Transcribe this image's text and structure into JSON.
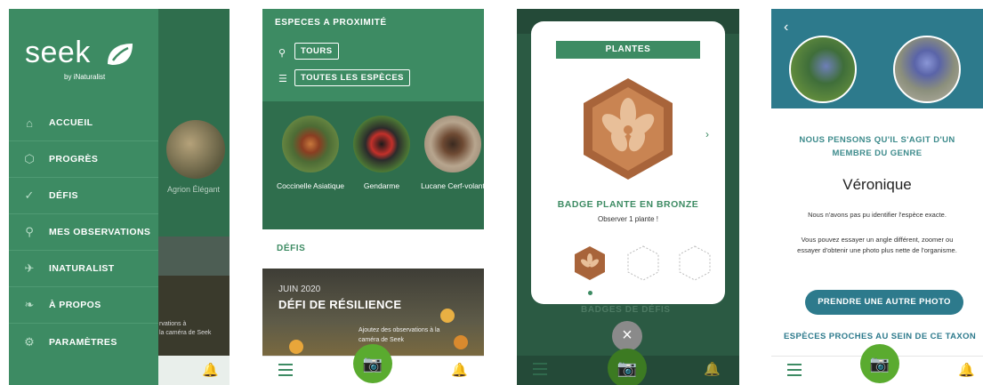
{
  "screen1": {
    "logo": "seek",
    "logo_sub": "by iNaturalist",
    "menu": [
      {
        "label": "ACCUEIL",
        "icon": "home-icon",
        "glyph": "⌂"
      },
      {
        "label": "PROGRÈS",
        "icon": "progress-icon",
        "glyph": "⬡"
      },
      {
        "label": "DÉFIS",
        "icon": "check-icon",
        "glyph": "✓"
      },
      {
        "label": "MES OBSERVATIONS",
        "icon": "search-icon",
        "glyph": "⚲"
      },
      {
        "label": "INATURALIST",
        "icon": "bird-icon",
        "glyph": "✈"
      },
      {
        "label": "À PROPOS",
        "icon": "leaf-icon",
        "glyph": "❧"
      },
      {
        "label": "PARAMÈTRES",
        "icon": "gear-icon",
        "glyph": "⚙"
      }
    ],
    "background_species": "Agrion Élégant",
    "background_text": "rvations à\nla caméra de Seek"
  },
  "screen2": {
    "header": "ESPECES A PROXIMITÉ",
    "location": "TOURS",
    "filter": "TOUTES LES ESPÈCES",
    "species": [
      {
        "name": "Coccinelle Asiatique",
        "color": "#a0573a"
      },
      {
        "name": "Gendarme",
        "color": "#b8302d"
      },
      {
        "name": "Lucane Cerf-volant",
        "color": "#7a5a3c"
      }
    ],
    "section_label": "DÉFIS",
    "challenge": {
      "date": "JUIN 2020",
      "title": "DÉFI DE RÉSILIENCE",
      "text": "Ajoutez des observations à la caméra de Seek"
    }
  },
  "screen3": {
    "ribbon": "PLANTES",
    "badge_title": "BADGE PLANTE EN BRONZE",
    "badge_sub": "Observer 1 plante !",
    "behind_label": "BADGES DE DÉFIS",
    "close_glyph": "×",
    "colors": {
      "bronze": "#a8643a",
      "bronze_light": "#d9a57a"
    }
  },
  "screen4": {
    "heading_line1": "NOUS PENSONS QU'IL S'AGIT D'UN",
    "heading_line2": "MEMBRE DU GENRE",
    "genus": "Véronique",
    "text1": "Nous n'avons pas pu identifier l'espèce exacte.",
    "text2": "Vous pouvez essayer un angle différent, zoomer ou essayer d'obtenir une photo plus nette de l'organisme.",
    "button": "PRENDRE UNE AUTRE PHOTO",
    "nearby": "ESPÈCES PROCHES AU SEIN DE CE TAXON"
  }
}
